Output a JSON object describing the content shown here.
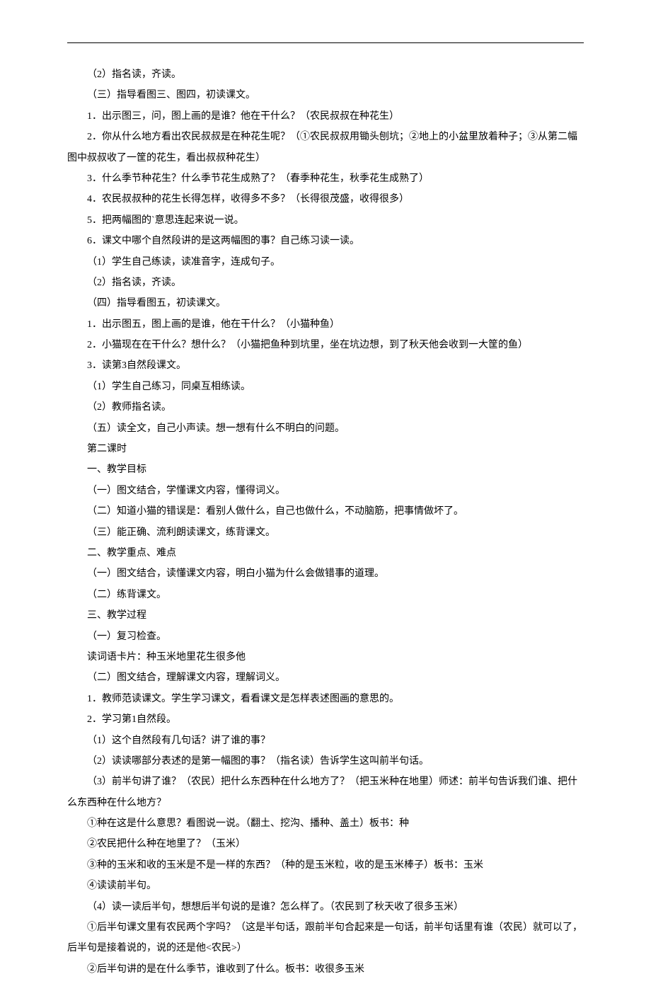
{
  "lines": [
    "（2）指名读，齐读。",
    "（三）指导看图三、图四，初读课文。",
    "1．出示图三，问，图上画的是谁？他在干什么？（农民叔叔在种花生）",
    "2．你从什么地方看出农民叔叔是在种花生呢？（①农民叔叔用锄头刨坑；②地上的小盆里放着种子；③从第二幅图中叔叔收了一筐的花生，看出叔叔种花生）",
    "3．什么季节种花生？什么季节花生成熟了？（春季种花生，秋季花生成熟了）",
    "4．农民叔叔种的花生长得怎样，收得多不多？（长得很茂盛，收得很多）",
    "5．把两幅图的`意思连起来说一说。",
    "6．课文中哪个自然段讲的是这两幅图的事？自己练习读一读。",
    "（1）学生自己练读，读准音字，连成句子。",
    "（2）指名读，齐读。",
    "（四）指导看图五，初读课文。",
    "1．出示图五，图上画的是谁，他在干什么？（小猫种鱼）",
    "2．小猫现在在干什么？想什么？（小猫把鱼种到坑里，坐在坑边想，到了秋天他会收到一大筐的鱼）",
    "3．读第3自然段课文。",
    "（1）学生自己练习，同桌互相练读。",
    "（2）教师指名读。",
    "（五）读全文，自己小声读。想一想有什么不明白的问题。",
    "第二课时",
    "一、教学目标",
    "（一）图文结合，学懂课文内容，懂得词义。",
    "（二）知道小猫的错误是：看别人做什么，自己也做什么，不动脑筋，把事情做坏了。",
    "（三）能正确、流利朗读课文，练背课文。",
    "二、教学重点、难点",
    "（一）图文结合，读懂课文内容，明白小猫为什么会做错事的道理。",
    "（二）练背课文。",
    "三、教学过程",
    "（一）复习检查。",
    "读词语卡片：种玉米地里花生很多他",
    "（二）图文结合，理解课文内容，理解词义。",
    "1．教师范读课文。学生学习课文，看看课文是怎样表述图画的意思的。",
    "2．学习第1自然段。",
    "（1）这个自然段有几句话？讲了谁的事？",
    "（2）读读哪部分表述的是第一幅图的事？（指名读）告诉学生这叫前半句话。",
    "（3）前半句讲了谁？（农民）把什么东西种在什么地方了？（把玉米种在地里）师述：前半句告诉我们谁、把什么东西种在什么地方？",
    "①种在这是什么意思？看图说一说。（翻土、挖沟、播种、盖土）板书：种",
    "②农民把什么种在地里了？（玉米）",
    "③种的玉米和收的玉米是不是一样的东西？（种的是玉米粒，收的是玉米棒子）板书：玉米",
    "④读读前半句。",
    "（4）读一读后半句，想想后半句说的是谁？怎么样了。（农民到了秋天收了很多玉米）",
    "①后半句课文里有农民两个字吗？（这是半句话，跟前半句合起来是一句话，前半句话里有谁（农民）就可以了，后半句是接着说的，说的还是他<农民>）",
    "②后半句讲的是在什么季节，谁收到了什么。板书：收很多玉米"
  ]
}
